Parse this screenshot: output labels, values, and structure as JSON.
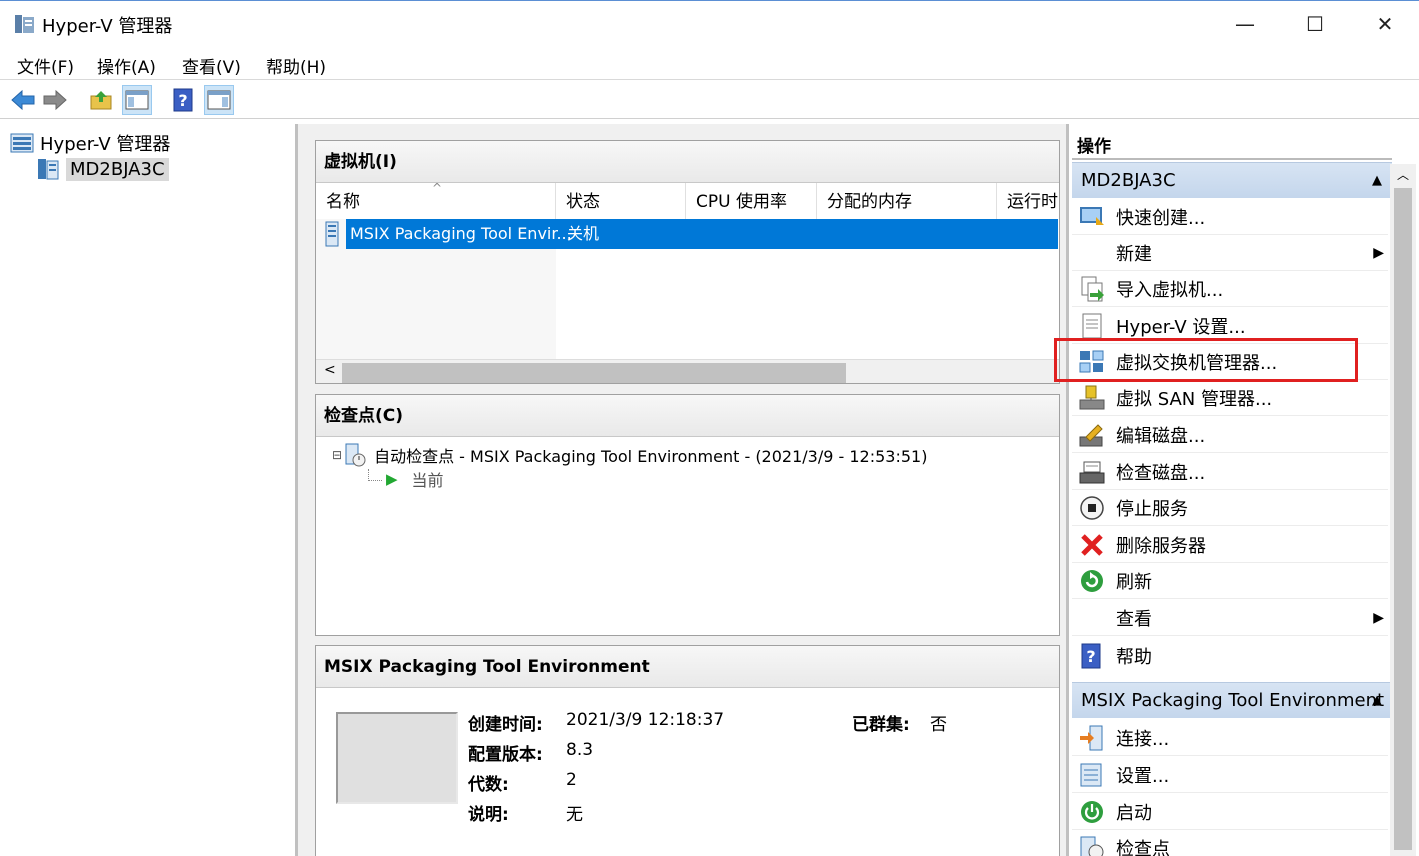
{
  "window": {
    "title": "Hyper-V 管理器",
    "minimize": "—",
    "maximize": "☐",
    "close": "✕"
  },
  "menu": [
    "文件(F)",
    "操作(A)",
    "查看(V)",
    "帮助(H)"
  ],
  "toolbar_icons": [
    "back-arrow-icon",
    "forward-arrow-icon",
    "folder-up-icon",
    "show-hide-console-tree-icon",
    "help-icon",
    "show-hide-action-pane-icon"
  ],
  "tree": {
    "root": "Hyper-V 管理器",
    "server": "MD2BJA3C"
  },
  "vm_section": {
    "title": "虚拟机(I)",
    "columns": [
      "名称",
      "状态",
      "CPU 使用率",
      "分配的内存",
      "运行时"
    ],
    "rows": [
      {
        "name": "MSIX Packaging Tool Envir...",
        "state": "关机"
      }
    ],
    "scroll_left": "<"
  },
  "checkpoint_section": {
    "title": "检查点(C)",
    "entry": "自动检查点 - MSIX Packaging Tool Environment - (2021/3/9 - 12:53:51)",
    "current": "当前"
  },
  "details": {
    "title": "MSIX Packaging Tool Environment",
    "created_label": "创建时间:",
    "created_value": "2021/3/9 12:18:37",
    "config_label": "配置版本:",
    "config_value": "8.3",
    "gen_label": "代数:",
    "gen_value": "2",
    "notes_label": "说明:",
    "notes_value": "无",
    "clustered_label": "已群集:",
    "clustered_value": "否"
  },
  "actions": {
    "title": "操作",
    "server_group": "MD2BJA3C",
    "server_items": [
      {
        "label": "快速创建...",
        "icon": "quick-create-icon"
      },
      {
        "label": "新建",
        "icon": "",
        "submenu": "▶"
      },
      {
        "label": "导入虚拟机...",
        "icon": "import-vm-icon"
      },
      {
        "label": "Hyper-V 设置...",
        "icon": "hyperv-settings-icon"
      },
      {
        "label": "虚拟交换机管理器...",
        "icon": "virtual-switch-icon"
      },
      {
        "label": "虚拟 SAN 管理器...",
        "icon": "virtual-san-icon"
      },
      {
        "label": "编辑磁盘...",
        "icon": "edit-disk-icon"
      },
      {
        "label": "检查磁盘...",
        "icon": "inspect-disk-icon"
      },
      {
        "label": "停止服务",
        "icon": "stop-service-icon"
      },
      {
        "label": "删除服务器",
        "icon": "remove-server-icon"
      },
      {
        "label": "刷新",
        "icon": "refresh-icon"
      },
      {
        "label": "查看",
        "icon": "",
        "submenu": "▶"
      },
      {
        "label": "帮助",
        "icon": "help-icon"
      }
    ],
    "vm_group": "MSIX Packaging Tool Environment",
    "vm_items": [
      {
        "label": "连接...",
        "icon": "connect-icon"
      },
      {
        "label": "设置...",
        "icon": "settings-icon"
      },
      {
        "label": "启动",
        "icon": "start-icon"
      },
      {
        "label": "检查点",
        "icon": "checkpoint-icon"
      }
    ],
    "collapse_caret": "▲"
  },
  "colors": {
    "selection": "#0078d7",
    "highlight_box": "#e02020",
    "group_header": "#c4d6ec"
  }
}
